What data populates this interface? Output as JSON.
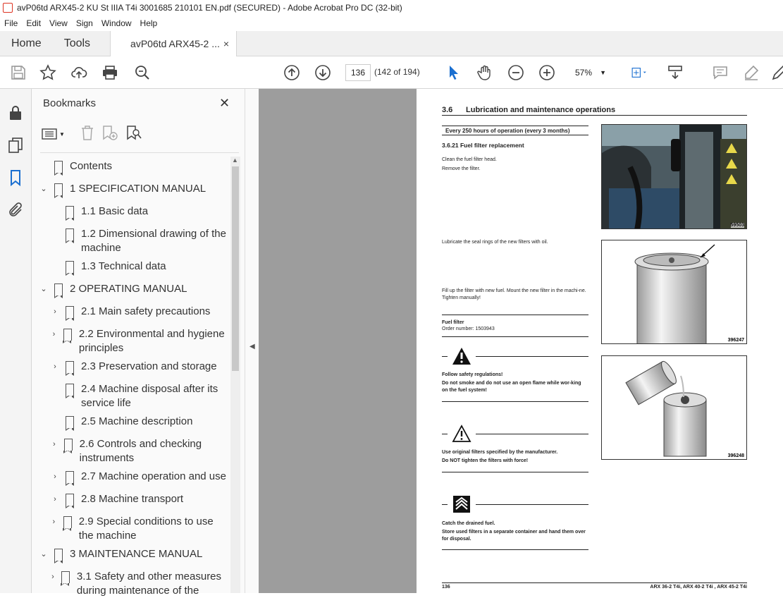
{
  "window": {
    "title": "avP06td ARX45-2 KU St IIIA T4i 3001685 210101 EN.pdf (SECURED) - Adobe Acrobat Pro DC (32-bit)"
  },
  "menu": [
    "File",
    "Edit",
    "View",
    "Sign",
    "Window",
    "Help"
  ],
  "tabs": {
    "home": "Home",
    "tools": "Tools",
    "doc": "avP06td ARX45-2 ...",
    "close": "×"
  },
  "toolbar": {
    "page_number": "136",
    "page_count": "(142 of 194)",
    "zoom": "57%"
  },
  "panel": {
    "title": "Bookmarks",
    "close": "✕"
  },
  "bookmarks": [
    {
      "label": "Contents",
      "level": 0,
      "toggle": ""
    },
    {
      "label": "1 SPECIFICATION MANUAL",
      "level": 0,
      "toggle": "expanded"
    },
    {
      "label": "1.1 Basic data",
      "level": 1,
      "toggle": ""
    },
    {
      "label": "1.2 Dimensional drawing of the machine",
      "level": 1,
      "toggle": ""
    },
    {
      "label": "1.3 Technical data",
      "level": 1,
      "toggle": ""
    },
    {
      "label": "2 OPERATING MANUAL",
      "level": 0,
      "toggle": "expanded"
    },
    {
      "label": "2.1 Main safety precautions",
      "level": 1,
      "toggle": "collapsed"
    },
    {
      "label": "2.2 Environmental and hygiene principles",
      "level": 1,
      "toggle": "collapsed"
    },
    {
      "label": "2.3 Preservation and storage",
      "level": 1,
      "toggle": "collapsed"
    },
    {
      "label": "2.4 Machine disposal after its service life",
      "level": 1,
      "toggle": ""
    },
    {
      "label": "2.5 Machine description",
      "level": 1,
      "toggle": ""
    },
    {
      "label": "2.6 Controls and checking instruments",
      "level": 1,
      "toggle": "collapsed"
    },
    {
      "label": "2.7 Machine operation and use",
      "level": 1,
      "toggle": "collapsed"
    },
    {
      "label": "2.8 Machine transport",
      "level": 1,
      "toggle": "collapsed"
    },
    {
      "label": "2.9 Special conditions to use the machine",
      "level": 1,
      "toggle": "collapsed"
    },
    {
      "label": "3 MAINTENANCE MANUAL",
      "level": 0,
      "toggle": "expanded"
    },
    {
      "label": "3.1 Safety and other measures during maintenance of the",
      "level": 1,
      "toggle": "collapsed"
    }
  ],
  "document": {
    "section_num": "3.6",
    "section_title": "Lubrication and maintenance operations",
    "interval": "Every 250 hours of operation (every 3 months)",
    "subsection": "3.6.21   Fuel filter replacement",
    "step1": "Clean the fuel filter head.",
    "step2": "Remove the filter.",
    "step3": "Lubricate the seal rings of the new filters with oil.",
    "step4": "Fill up the filter with new fuel. Mount the new filter in the machi-ne. Tighten manually!",
    "part_name": "Fuel filter",
    "part_order": "Order number: 1503943",
    "warn1_a": "Follow safety regulations!",
    "warn1_b": "Do not smoke and do not use an open flame while wor-king on the fuel system!",
    "warn2_a": "Use original filters specified by the manufacturer.",
    "warn2_b": "Do NOT tighten the filters with force!",
    "env_a": "Catch the drained fuel.",
    "env_b": "Store used filters in a separate container and hand them over for disposal.",
    "fig1": "59503",
    "fig2": "396247",
    "fig3": "396248",
    "footer_page": "136",
    "footer_models": "ARX 36-2 T4i, ARX 40-2 T4i , ARX 45-2 T4i"
  }
}
